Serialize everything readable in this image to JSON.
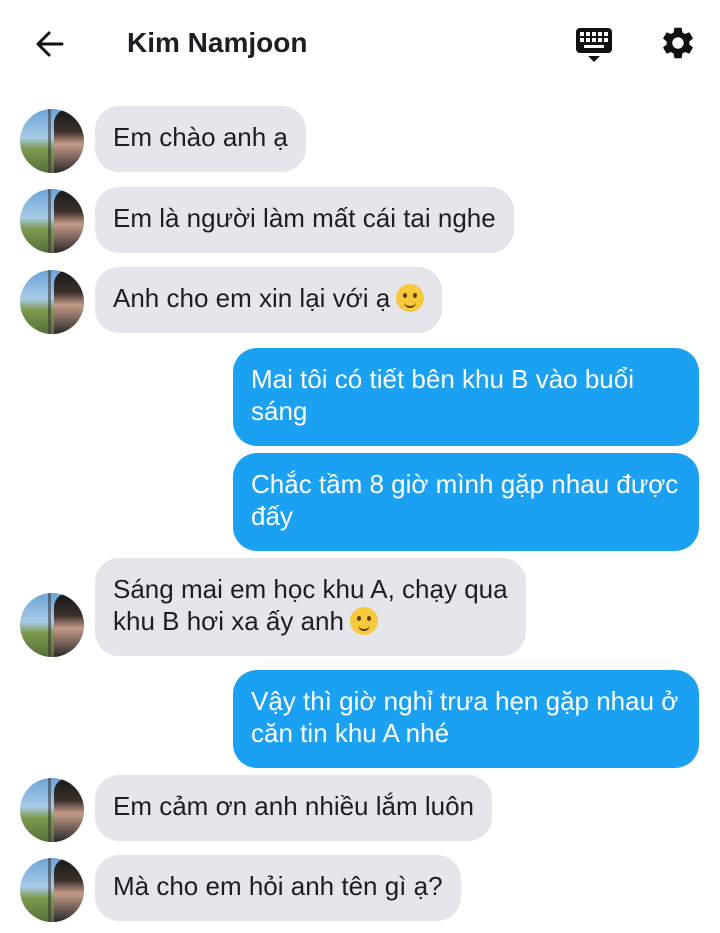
{
  "header": {
    "title": "Kim Namjoon",
    "back_icon": "arrow-left-icon",
    "keyboard_icon": "keyboard-icon",
    "settings_icon": "gear-icon"
  },
  "messages": [
    {
      "side": "in",
      "text": "Em chào anh ạ"
    },
    {
      "side": "in",
      "text": "Em là người làm mất cái tai nghe"
    },
    {
      "side": "in",
      "text": "Anh cho em xin lại với ạ",
      "emoji": "smiling-face-icon"
    },
    {
      "side": "out",
      "text": "Mai tôi có tiết bên khu B vào buổi sáng"
    },
    {
      "side": "out",
      "text": "Chắc tầm 8 giờ mình gặp nhau được đấy"
    },
    {
      "side": "in",
      "line1": "Sáng mai em học khu A, chạy qua",
      "line2": "khu B hơi xa ấy anh",
      "emoji": "smiling-face-with-tear-icon"
    },
    {
      "side": "out",
      "text": "Vậy thì giờ nghỉ trưa hẹn gặp nhau ở căn tin khu A nhé"
    },
    {
      "side": "in",
      "text": "Em cảm ơn anh nhiều lắm luôn"
    },
    {
      "side": "in",
      "text": "Mà cho em hỏi anh tên gì ạ?"
    }
  ],
  "colors": {
    "incoming_bubble": "#e4e6eb",
    "outgoing_bubble": "#1ba1f2",
    "outgoing_text": "#ffffff"
  }
}
